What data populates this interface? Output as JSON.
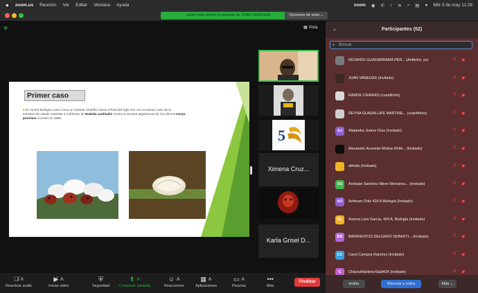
{
  "menubar": {
    "app": "zoom.us",
    "items": [
      "Reunión",
      "Ver",
      "Editar",
      "Ventana",
      "Ayuda"
    ],
    "brand": "zoom",
    "datetime": "Mié 3 de may 11:28"
  },
  "titlebar": {
    "share_banner": "Usted está viendo la pantalla de JUAN VANEGAS",
    "view_options": "Opciones de vista ⌄"
  },
  "main": {
    "view_button": "Vista"
  },
  "slide": {
    "title": "Primer caso",
    "text_1": "El control biológico nace como un método científico hacia el final del siglo XIX con el exitoso caso de la introducción desde Australia a California de ",
    "text_bold_1": "Rodolia cardinalis",
    "text_2": " contra la escama algodonosa de los cítricos ",
    "text_bold_2": "Icerya purchasi",
    "text_3": " ocurrido en 1888."
  },
  "thumbnails": [
    {
      "label": ""
    },
    {
      "label": ""
    },
    {
      "label": ""
    },
    {
      "label": "Ximena Cruz..."
    },
    {
      "label": ""
    },
    {
      "label": "Karla Grisel D..."
    }
  ],
  "toolbar": {
    "items": [
      {
        "label": "Reactivar audio",
        "icon": "mic-muted-icon"
      },
      {
        "label": "Iniciar video",
        "icon": "video-off-icon"
      },
      {
        "label": "Seguridad",
        "icon": "shield-icon"
      },
      {
        "label": "Compartir pantalla",
        "icon": "share-screen-icon"
      },
      {
        "label": "Reacciones",
        "icon": "reactions-icon"
      },
      {
        "label": "Aplicaciones",
        "icon": "apps-icon"
      },
      {
        "label": "Pizarras",
        "icon": "whiteboard-icon"
      },
      {
        "label": "Más",
        "icon": "more-icon"
      }
    ],
    "end_label": "Finalizar",
    "accent": "#27b23c",
    "end_color": "#e03a3a"
  },
  "participants": {
    "header": "Participantes (52)",
    "search_placeholder": "Buscar",
    "list": [
      {
        "initials": "",
        "name": "RICARDO GUADARRAMA PER...  (Anfitrión, yo)",
        "color": "#7a7a7a"
      },
      {
        "initials": "",
        "name": "JUAN VANEGAS (Invitado)",
        "color": "#3a2a22"
      },
      {
        "initials": "",
        "name": "RAMSE CHAIRES (coanfitrión)",
        "color": "#d8d8d8"
      },
      {
        "initials": "",
        "name": "REYNA GUADALUPE MARTINE...  (coanfitrión)",
        "color": "#cfcfcf"
      },
      {
        "initials": "AJ",
        "name": "Alejandra Juárez Díaz (Invitado)",
        "color": "#8f5fd0"
      },
      {
        "initials": "",
        "name": "Alexander Acevedo Molina 424A...  (Invitado)",
        "color": "#0d0d0d"
      },
      {
        "initials": "",
        "name": "alfredo (Invitado)",
        "color": "#f0b429"
      },
      {
        "initials": "AS",
        "name": "Andrade Sanchez Miren Monserra...  (Invitado)",
        "color": "#3fb950"
      },
      {
        "initials": "AO",
        "name": "Anthoan Ortiz 424 A Biología (Invitado)",
        "color": "#8f5fd0"
      },
      {
        "initials": "AL",
        "name": "Aranza Lara García, 424 A, Biología (Invitado)",
        "color": "#f0b429"
      },
      {
        "initials": "BD",
        "name": "BARRIENTOS DELGADO SEBASTI...  (Invitado)",
        "color": "#b06ad8"
      },
      {
        "initials": "CC",
        "name": "Carol Campos Ramírez (Invitado)",
        "color": "#3aa0e0"
      },
      {
        "initials": "C",
        "name": "ChávezMartinezSaúl424 (Invitado)",
        "color": "#c060d0"
      }
    ],
    "footer": {
      "invite": "Invitar",
      "mute_all": "Silenciar a todos",
      "more": "Más ⌄"
    }
  }
}
